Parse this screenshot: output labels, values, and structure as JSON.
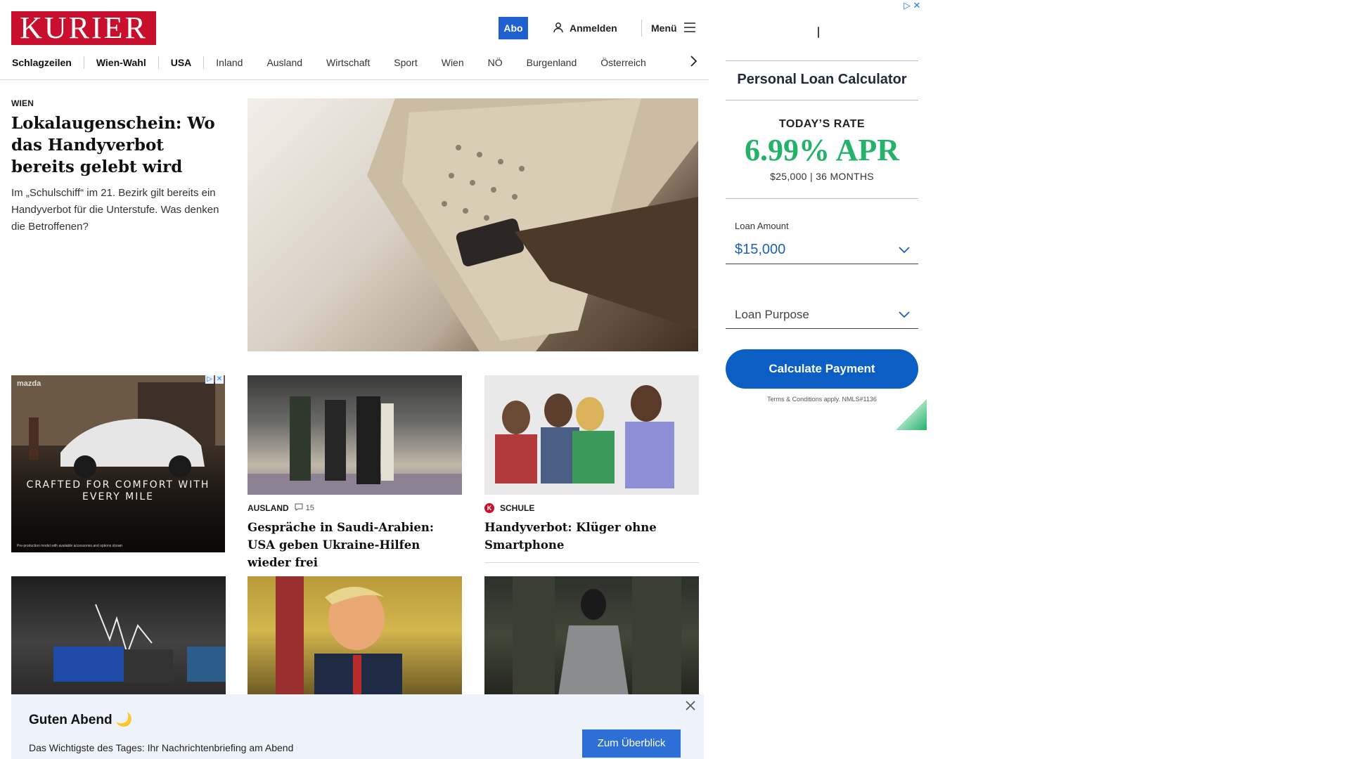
{
  "header": {
    "logo": "KURIER",
    "abo_label": "Abo",
    "login_label": "Anmelden",
    "menu_label": "Menü"
  },
  "nav": {
    "items": [
      "Schlagzeilen",
      "Wien-Wahl",
      "USA",
      "Inland",
      "Ausland",
      "Wirtschaft",
      "Sport",
      "Wien",
      "NÖ",
      "Burgenland",
      "Österreich"
    ]
  },
  "lead": {
    "kicker": "WIEN",
    "title": "Lokalaugenschein: Wo das Handyverbot bereits gelebt wird",
    "teaser": "Im „Schulschiff“ im 21. Bezirk gilt bereits ein Handyverbot für die Unterstufe. Was denken die Betroffenen?"
  },
  "car_ad": {
    "headline": "CRAFTED FOR COMFORT WITH EVERY MILE",
    "brand": "mazda",
    "disclaimer": "Pre-production model with available accessories and options shown"
  },
  "cards": [
    {
      "kicker": "AUSLAND",
      "comments": "15",
      "title": "Gespräche in Saudi-Arabien: USA geben Ukraine-Hilfen wieder frei"
    },
    {
      "kicker": "SCHULE",
      "badge": "K",
      "title": "Handyverbot: Klüger ohne Smartphone"
    }
  ],
  "loan_ad": {
    "title": "Personal Loan Calculator",
    "rate_label": "TODAY’S RATE",
    "rate": "6.99% APR",
    "terms": "$25,000 | 36 MONTHS",
    "amount_label": "Loan Amount",
    "amount_value": "$15,000",
    "purpose_placeholder": "Loan Purpose",
    "button_label": "Calculate Payment",
    "footnote": "Terms & Conditions apply. NMLS#1136",
    "accent_color": "#24b26a",
    "button_color": "#0b5fc4"
  },
  "briefing": {
    "title": "Guten Abend 🌙",
    "text": "Das Wichtigste des Tages: Ihr Nachrichtenbriefing am Abend",
    "button_label": "Zum Überblick"
  },
  "colors": {
    "brand_red": "#c8102e",
    "abo_blue": "#1f5fd0"
  }
}
